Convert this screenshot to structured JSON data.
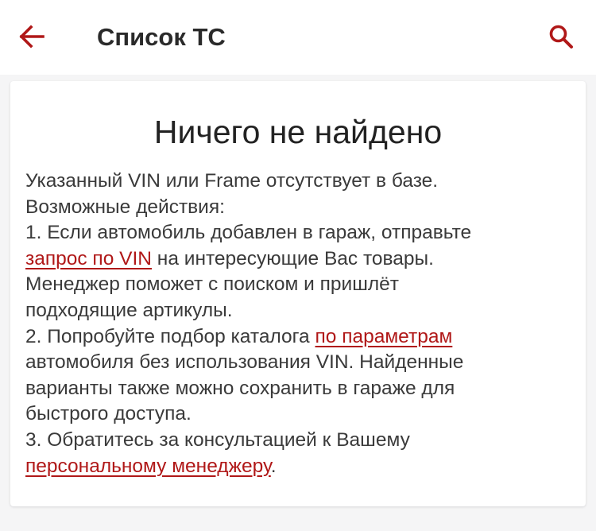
{
  "header": {
    "title": "Список ТС",
    "back_icon": "arrow-left-icon",
    "search_icon": "search-icon",
    "accent_color": "#b01818"
  },
  "card": {
    "title": "Ничего не найдено",
    "lines": {
      "l1": "Указанный VIN или Frame отсутствует в базе.",
      "l2": "Возможные действия:",
      "l3": "1. Если автомобиль добавлен в гараж, отправьте",
      "l4_link": "запрос по VIN",
      "l4_text": " на интересующие Вас товары.",
      "l5": "Менеджер поможет с поиском и пришлёт",
      "l6": "подходящие артикулы.",
      "l7_text": "2. Попробуйте подбор каталога ",
      "l7_link": "по параметрам",
      "l8": "автомобиля без использования VIN. Найденные",
      "l9": "варианты также можно сохранить в гараже для",
      "l10": "быстрого доступа.",
      "l11": "3. Обратитесь за консультацией к Вашему",
      "l12_link": "персональному менеджеру",
      "l12_text": "."
    }
  }
}
